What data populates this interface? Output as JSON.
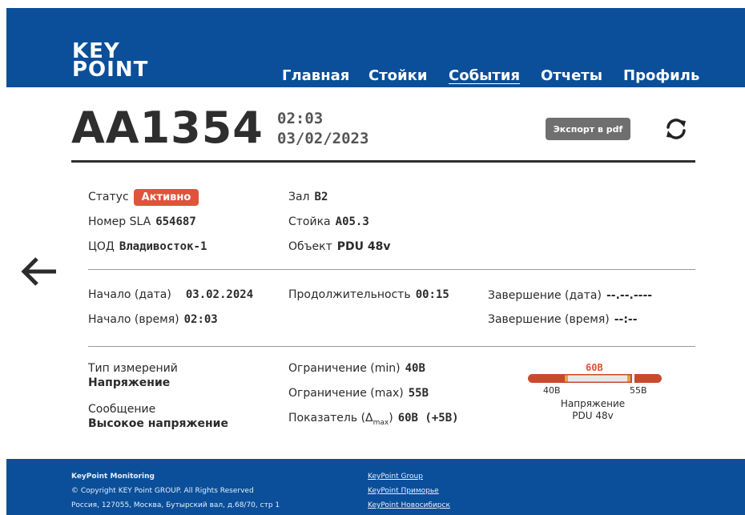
{
  "header": {
    "logo_line1": "KEY",
    "logo_line2": "POINT",
    "nav": [
      {
        "label": "Главная"
      },
      {
        "label": "Стойки"
      },
      {
        "label": "События"
      },
      {
        "label": "Отчеты"
      },
      {
        "label": "Профиль"
      }
    ],
    "active_nav": "События",
    "brand_color": "#0b4f9a"
  },
  "event": {
    "id": "AA1354",
    "time": "02:03",
    "date": "03/02/2023",
    "export_label": "Экспорт в pdf",
    "refresh_icon": "refresh-icon"
  },
  "info": {
    "status_label": "Статус",
    "status_value": "Активно",
    "status_color": "#e0533a",
    "sla_label": "Номер SLA",
    "sla_value": "654687",
    "dc_label": "ЦОД",
    "dc_value": "Владивосток-1",
    "hall_label": "Зал",
    "hall_value": "B2",
    "rack_label": "Стойка",
    "rack_value": "A05.3",
    "object_label": "Объект",
    "object_value": "PDU 48v"
  },
  "timing": {
    "start_date_label": "Начало (дата)",
    "start_date_value": "03.02.2024",
    "start_time_label": "Начало (время)",
    "start_time_value": "02:03",
    "duration_label": "Продолжительность",
    "duration_value": "00:15",
    "end_date_label": "Завершение (дата)",
    "end_date_value": "--.--.----",
    "end_time_label": "Завершение (время)",
    "end_time_value": "--:--"
  },
  "measure": {
    "type_label": "Тип измерений",
    "type_value": "Напряжение",
    "message_label": "Сообщение",
    "message_value": "Высокое напряжение",
    "min_label": "Ограничение (min)",
    "min_value": "40В",
    "max_label": "Ограничение (max)",
    "max_value": "55В",
    "indicator_label_prefix": "Показатель (Δ",
    "indicator_label_sub": "max",
    "indicator_label_suffix": ")",
    "indicator_value": "60В (+5В)"
  },
  "gauge": {
    "current_label": "60В",
    "min_label": "40В",
    "max_label": "55В",
    "caption_line1": "Напряжение",
    "caption_line2": "PDU 48v",
    "alarm_color": "#e0533a"
  },
  "footer": {
    "company": "KeyPoint Monitoring",
    "copyright": "© Copyright KEY Point GROUP. All Rights Reserved",
    "address": "Россия, 127055, Москва, Бутырский вал, д.68/70, стр 1",
    "links": [
      {
        "label": "KeyPoint Group"
      },
      {
        "label": "KeyPoint Приморье"
      },
      {
        "label": "KeyPoint Новосибирск"
      }
    ]
  }
}
